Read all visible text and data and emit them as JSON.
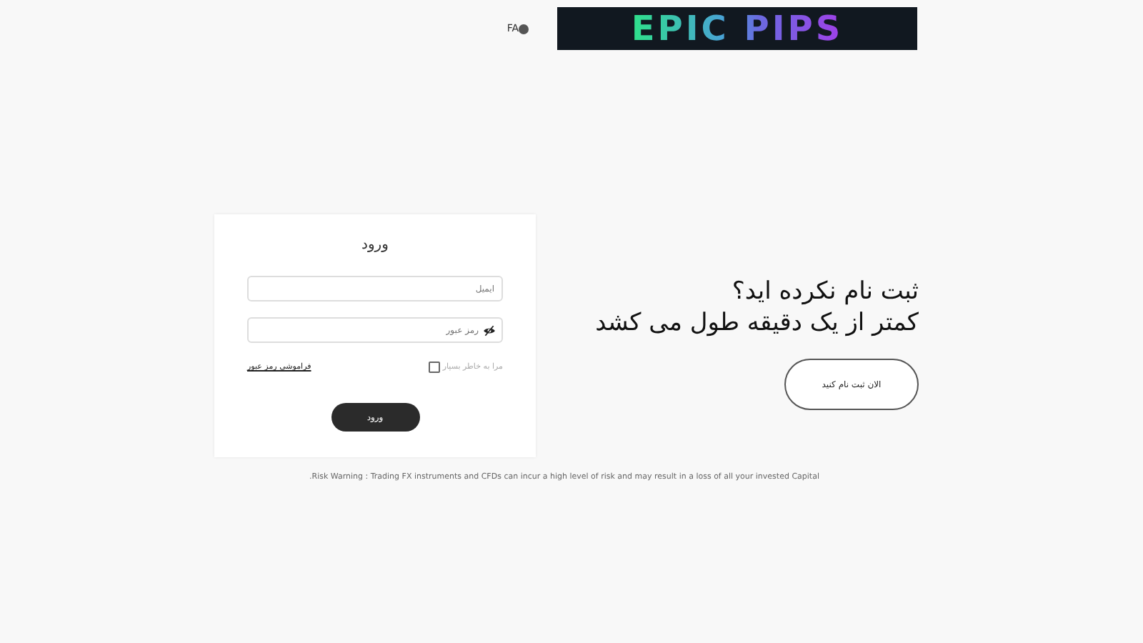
{
  "header": {
    "language": "FA",
    "logo": "EPIC PIPS"
  },
  "login": {
    "title": "ورود",
    "email": {
      "placeholder": "ایمیل"
    },
    "password": {
      "placeholder": "رمز عبور"
    },
    "remember": {
      "label": "مرا به خاطر بسپار",
      "checked": false
    },
    "forgot_link": "فراموشی رمز عبور",
    "submit": "ورود"
  },
  "register": {
    "heading": "ثبت نام نکرده اید؟",
    "subheading": "کمتر از یک دقیقه طول می کشد",
    "button": "الان ثبت نام کنید"
  },
  "risk_warning": ".Risk Warning : Trading FX instruments and CFDs can incur a high level of risk and may result in a loss of all your invested Capital"
}
